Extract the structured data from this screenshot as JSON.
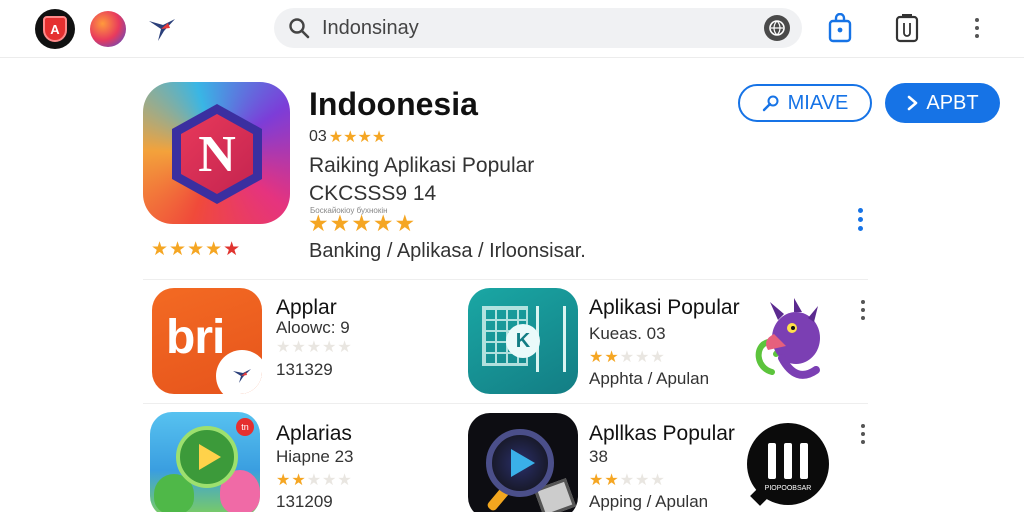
{
  "topbar": {
    "search_text": "Indonsinay",
    "tab1_glyph": "A",
    "icons": [
      "app-tab-icon",
      "orb-tab-icon",
      "bird-logo-icon",
      "search-icon",
      "globe-icon",
      "bag-icon",
      "clipboard-icon",
      "more-vert-icon"
    ]
  },
  "featured": {
    "title": "Indoonesia",
    "rating_prefix": "03",
    "rating_stars": "★★★★",
    "subtitle": "Raiking  Aplikasi Popular",
    "code": "CKCSSS9  14",
    "small_text": "Боскайокіоу бухнокін",
    "stars_large": "★★★★★",
    "stars_under": "★★★★",
    "stars_under_last": "★",
    "categories": "Banking /  Aplikasa /  Irloonsisar.",
    "icon_letter": "N",
    "btn_outline_label": "MIAVE",
    "btn_fill_label": "APBT"
  },
  "apps": [
    {
      "name": "Applar",
      "meta1": "Aloowc: 9",
      "meta2": "131329",
      "icon_text": "bri",
      "stars_filled": "",
      "stars_empty": "★★★★★"
    },
    {
      "name": "Aplikasi Popular",
      "meta1": "Kueas. 03",
      "meta2": "Apphta /  Apulan",
      "icon_text": "K",
      "stars_filled": "★★",
      "stars_empty": "★★★"
    },
    {
      "name": "Aplarias",
      "meta1": "Hiapne 23",
      "meta2": "131209",
      "icon_text": "tn",
      "stars_filled": "★★",
      "stars_empty": "★★★"
    },
    {
      "name": "Apllkas Popular",
      "meta1": "38",
      "meta2": "Apping /  Apulan",
      "icon_text": "",
      "stars_filled": "★★",
      "stars_empty": "★★★"
    }
  ],
  "badge_text": "PIOPOOBSAR",
  "colors": {
    "accent": "#1673e6",
    "star": "#f5a623",
    "bri": "#f36a23",
    "teal": "#1aa7a4"
  }
}
